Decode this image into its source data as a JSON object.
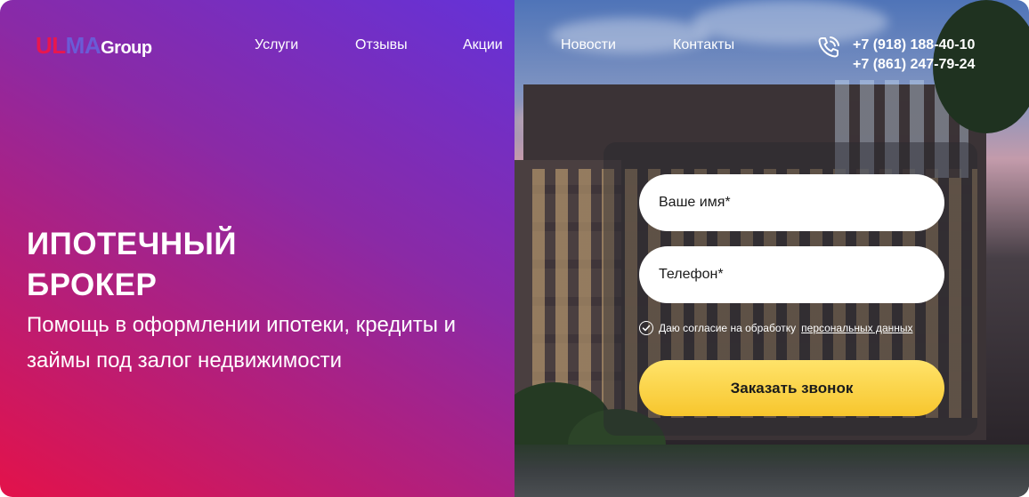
{
  "brand": {
    "part1": "UL",
    "part2": "MA",
    "part3": "Group"
  },
  "nav": {
    "items": [
      {
        "label": "Услуги"
      },
      {
        "label": "Отзывы"
      },
      {
        "label": "Акции"
      },
      {
        "label": "Новости"
      },
      {
        "label": "Контакты"
      }
    ]
  },
  "contacts": {
    "phone_icon": "phone-icon",
    "phone1": "+7 (918) 188-40-10",
    "phone2": "+7 (861) 247-79-24"
  },
  "hero": {
    "title_line1": "ИПОТЕЧНЫЙ",
    "title_line2": "БРОКЕР",
    "subtitle": "Помощь в оформлении ипотеки, кредиты и займы под залог недвижимости"
  },
  "form": {
    "name_placeholder": "Ваше имя*",
    "phone_placeholder": "Телефон*",
    "consent_text": "Даю согласие на обработку",
    "consent_link": "персональных данных",
    "submit_label": "Заказать звонок"
  },
  "colors": {
    "brand_red": "#e8174f",
    "brand_purple": "#6a5bd6",
    "gradient_start": "#e3124a",
    "gradient_end": "#6432d8",
    "cta_yellow": "#f7c62d"
  }
}
